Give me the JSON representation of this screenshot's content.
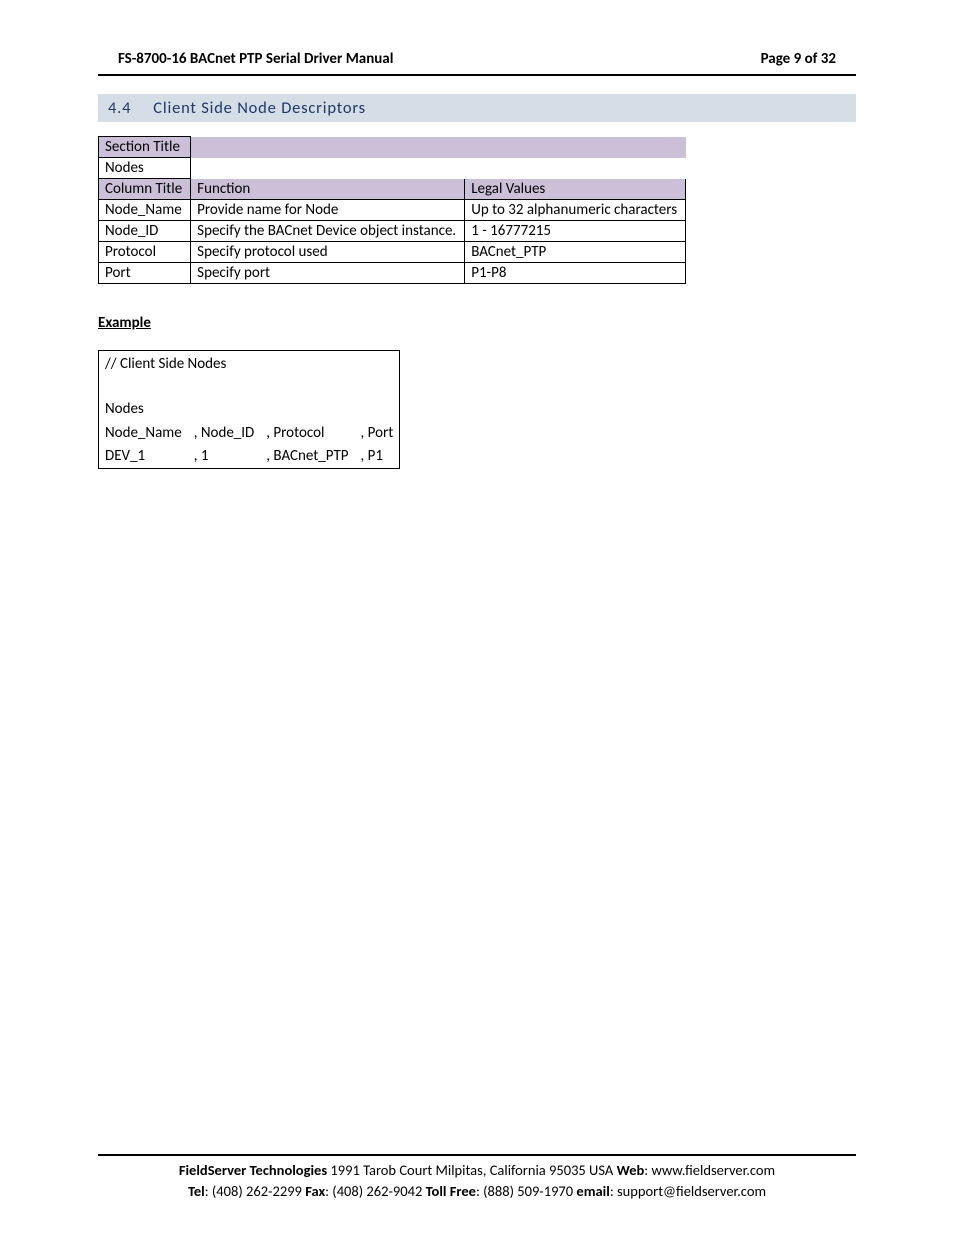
{
  "header": {
    "title": "FS-8700-16 BACnet PTP Serial Driver Manual",
    "page_label": "Page 9 of 32"
  },
  "section": {
    "number": "4.4",
    "title": "Client Side Node Descriptors"
  },
  "table": {
    "section_title_label": "Section Title",
    "section_title_value": "Nodes",
    "col_header": [
      "Column Title",
      "Function",
      "Legal Values"
    ],
    "rows": [
      {
        "c0": "Node_Name",
        "c1": "Provide name for Node",
        "c2": "Up to 32 alphanumeric characters"
      },
      {
        "c0": "Node_ID",
        "c1": "Specify the BACnet Device object instance.",
        "c2": "1 - 16777215"
      },
      {
        "c0": "Protocol",
        "c1": "Specify protocol used",
        "c2": "BACnet_PTP"
      },
      {
        "c0": "Port",
        "c1": "Specify port",
        "c2": "P1-P8"
      }
    ]
  },
  "example_label": "Example",
  "code": {
    "comment": "//    Client Side Nodes",
    "section": "Nodes",
    "headers": {
      "c0": "Node_Name",
      "c1": ", Node_ID",
      "c2": ", Protocol",
      "c3": ", Port"
    },
    "row": {
      "c0": "DEV_1",
      "c1": ", 1",
      "c2": ", BACnet_PTP",
      "c3": ", P1"
    }
  },
  "footer": {
    "line1_company": "FieldServer Technologies",
    "line1_address": " 1991 Tarob Court Milpitas, California 95035 USA   ",
    "line1_web_label": "Web",
    "line1_web": ": www.fieldserver.com",
    "line2_tel_label": "Tel",
    "line2_tel": ": (408) 262-2299   ",
    "line2_fax_label": "Fax",
    "line2_fax": ": (408) 262-9042   ",
    "line2_tollfree_label": "Toll Free",
    "line2_tollfree": ": (888) 509-1970   ",
    "line2_email_label": "email",
    "line2_email": ": support@fieldserver.com"
  }
}
